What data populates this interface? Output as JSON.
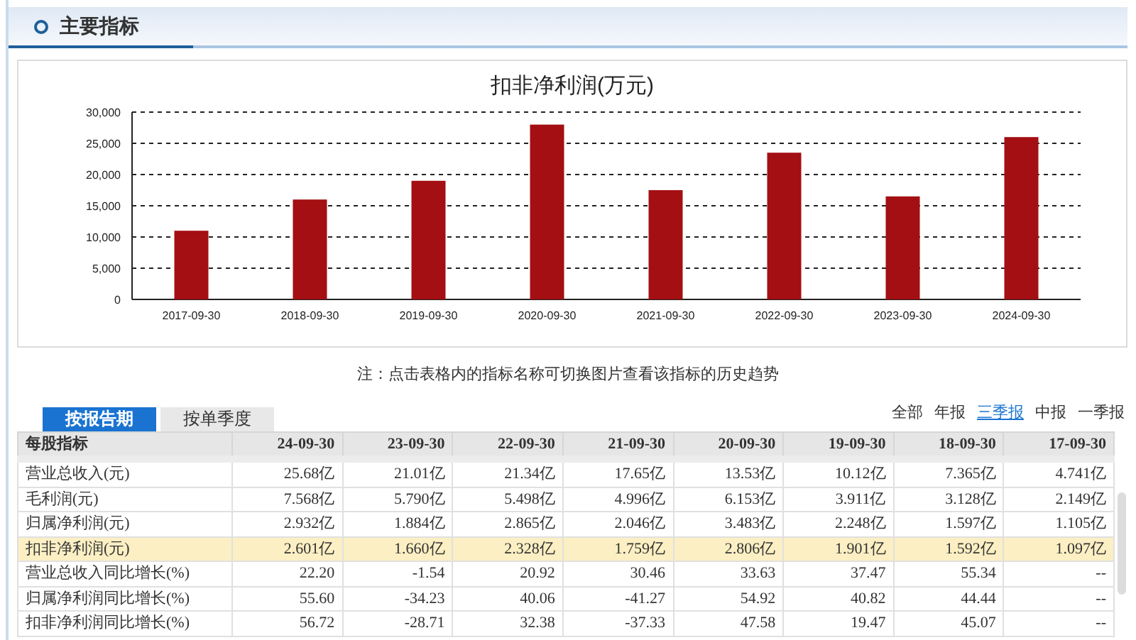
{
  "section": {
    "title": "主要指标"
  },
  "chart": {
    "chart_data": {
      "type": "bar",
      "title": "扣非净利润(万元)",
      "categories": [
        "2017-09-30",
        "2018-09-30",
        "2019-09-30",
        "2020-09-30",
        "2021-09-30",
        "2022-09-30",
        "2023-09-30",
        "2024-09-30"
      ],
      "series": [
        {
          "color": "#a30f12",
          "values": [
            11000,
            16000,
            19000,
            28000,
            17500,
            23500,
            16500,
            26000
          ]
        }
      ],
      "grid": true,
      "ylim": [
        0,
        30000
      ],
      "yticks": [
        {
          "value": 0,
          "label": "0"
        },
        {
          "value": 5000,
          "label": "5,000"
        },
        {
          "value": 10000,
          "label": "10,000"
        },
        {
          "value": 15000,
          "label": "15,000"
        },
        {
          "value": 20000,
          "label": "20,000"
        },
        {
          "value": 25000,
          "label": "25,000"
        },
        {
          "value": 30000,
          "label": "30,000"
        }
      ]
    }
  },
  "note": "注：点击表格内的指标名称可切换图片查看该指标的历史趋势",
  "tabs": [
    {
      "label": "按报告期",
      "selected": true
    },
    {
      "label": "按单季度",
      "selected": false
    }
  ],
  "filters": [
    {
      "label": "全部",
      "selected": false
    },
    {
      "label": "年报",
      "selected": false
    },
    {
      "label": "三季报",
      "selected": true
    },
    {
      "label": "中报",
      "selected": false
    },
    {
      "label": "一季报",
      "selected": false
    }
  ],
  "table": {
    "columns": [
      "每股指标",
      "24-09-30",
      "23-09-30",
      "22-09-30",
      "21-09-30",
      "20-09-30",
      "19-09-30",
      "18-09-30",
      "17-09-30"
    ],
    "rows": [
      {
        "name": "营业总收入(元)",
        "selected": false,
        "values": [
          "25.68亿",
          "21.01亿",
          "21.34亿",
          "17.65亿",
          "13.53亿",
          "10.12亿",
          "7.365亿",
          "4.741亿"
        ]
      },
      {
        "name": "毛利润(元)",
        "selected": false,
        "values": [
          "7.568亿",
          "5.790亿",
          "5.498亿",
          "4.996亿",
          "6.153亿",
          "3.911亿",
          "3.128亿",
          "2.149亿"
        ]
      },
      {
        "name": "归属净利润(元)",
        "selected": false,
        "values": [
          "2.932亿",
          "1.884亿",
          "2.865亿",
          "2.046亿",
          "3.483亿",
          "2.248亿",
          "1.597亿",
          "1.105亿"
        ]
      },
      {
        "name": "扣非净利润(元)",
        "selected": true,
        "values": [
          "2.601亿",
          "1.660亿",
          "2.328亿",
          "1.759亿",
          "2.806亿",
          "1.901亿",
          "1.592亿",
          "1.097亿"
        ]
      },
      {
        "name": "营业总收入同比增长(%)",
        "selected": false,
        "values": [
          "22.20",
          "-1.54",
          "20.92",
          "30.46",
          "33.63",
          "37.47",
          "55.34",
          "--"
        ]
      },
      {
        "name": "归属净利润同比增长(%)",
        "selected": false,
        "values": [
          "55.60",
          "-34.23",
          "40.06",
          "-41.27",
          "54.92",
          "40.82",
          "44.44",
          "--"
        ]
      },
      {
        "name": "扣非净利润同比增长(%)",
        "selected": false,
        "values": [
          "56.72",
          "-28.71",
          "32.38",
          "-37.33",
          "47.58",
          "19.47",
          "45.07",
          "--"
        ]
      }
    ]
  }
}
